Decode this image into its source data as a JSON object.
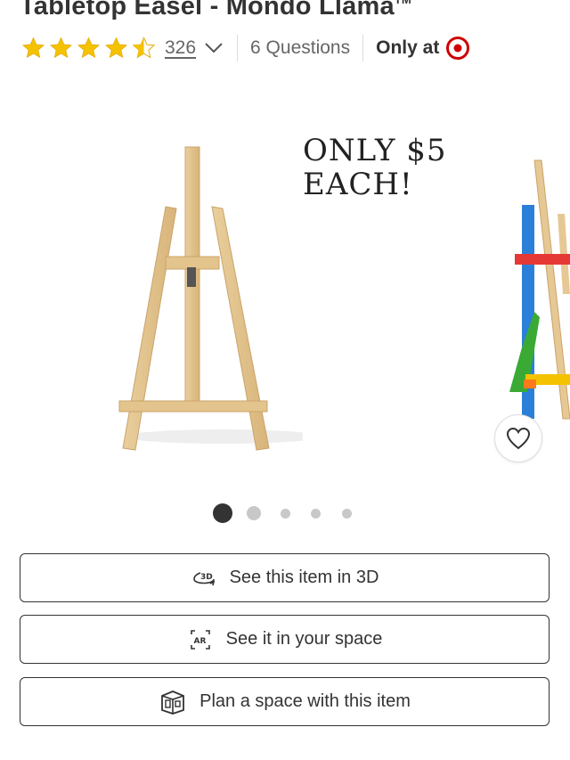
{
  "product": {
    "title": "Tabletop Easel - Mondo Llama",
    "trademark": "TM"
  },
  "rating": {
    "stars": 4.5,
    "star_color": "#f5c200",
    "review_count": "326",
    "questions": "6 Questions",
    "only_at": "Only at",
    "brand_color": "#cc0000"
  },
  "carousel": {
    "promo_line1": "ONLY $5",
    "promo_line2": "EACH!",
    "active_index": 0,
    "total": 5
  },
  "favorite": {
    "icon": "heart-icon"
  },
  "actions": [
    {
      "label": "See this item in 3D",
      "icon": "3d-rotate-icon"
    },
    {
      "label": "See it in your space",
      "icon": "ar-icon"
    },
    {
      "label": "Plan a space with this item",
      "icon": "room-plan-icon"
    }
  ]
}
